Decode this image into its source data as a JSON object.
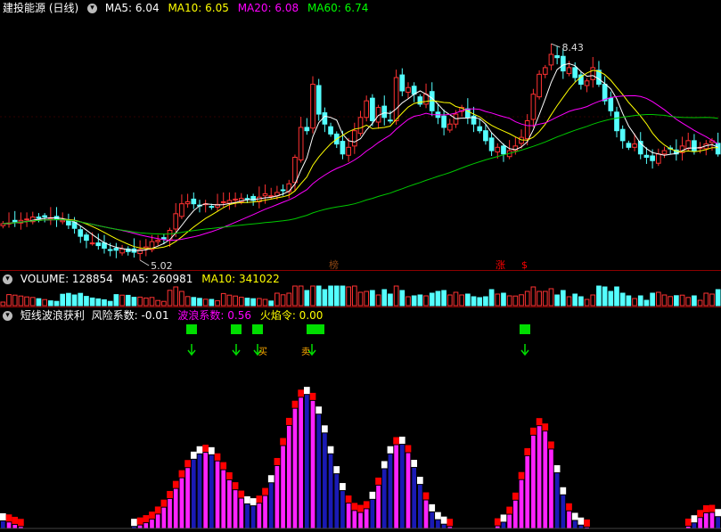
{
  "main_panel": {
    "title": "建投能源 (日线)",
    "legend": [
      {
        "label": "MA5: 6.04",
        "color": "#ffffff"
      },
      {
        "label": "MA10: 6.05",
        "color": "#ffff00"
      },
      {
        "label": "MA20: 6.08",
        "color": "#ff00ff"
      },
      {
        "label": "MA60: 6.74",
        "color": "#00ff00"
      }
    ],
    "high_label": "8.43",
    "low_label": "5.02",
    "badges": [
      "榜",
      "涨",
      "$"
    ]
  },
  "volume_panel": {
    "legend": [
      {
        "label": "VOLUME: 128854",
        "color": "#ffffff"
      },
      {
        "label": "MA5: 260981",
        "color": "#ffffff"
      },
      {
        "label": "MA10: 341022",
        "color": "#ffff00"
      }
    ]
  },
  "indicator_panel": {
    "legend": [
      {
        "label": "短线波浪获利",
        "color": "#ffffff"
      },
      {
        "label": "风险系数: -0.01",
        "color": "#ffffff"
      },
      {
        "label": "波浪系数: 0.56",
        "color": "#ff00ff"
      },
      {
        "label": "火焰令: 0.00",
        "color": "#ffff00"
      }
    ],
    "icon_labels": [
      "买",
      "卖"
    ]
  },
  "chart_data": {
    "type": "candlestick",
    "high": 8.43,
    "low": 5.02,
    "ma_last": {
      "MA5": 6.04,
      "MA10": 6.05,
      "MA20": 6.08,
      "MA60": 6.74
    },
    "volume_last": {
      "VOLUME": 128854,
      "MA5": 260981,
      "MA10": 341022
    },
    "indicator_last": {
      "风险系数": -0.01,
      "波浪系数": 0.56,
      "火焰令": 0.0
    },
    "closes": [
      5.45,
      5.46,
      5.48,
      5.5,
      5.52,
      5.55,
      5.53,
      5.55,
      5.54,
      5.52,
      5.5,
      5.43,
      5.38,
      5.26,
      5.2,
      5.16,
      5.12,
      5.08,
      5.06,
      5.05,
      5.07,
      5.03,
      5.02,
      5.06,
      5.1,
      5.18,
      5.2,
      5.22,
      5.35,
      5.6,
      5.75,
      5.78,
      5.75,
      5.72,
      5.75,
      5.7,
      5.74,
      5.78,
      5.8,
      5.82,
      5.83,
      5.82,
      5.8,
      5.85,
      5.9,
      5.87,
      5.92,
      5.95,
      6.05,
      6.45,
      6.9,
      6.85,
      7.55,
      7.1,
      6.95,
      6.8,
      6.65,
      6.5,
      6.6,
      6.85,
      7.05,
      7.3,
      7.0,
      7.2,
      7.05,
      7.0,
      7.65,
      7.45,
      7.5,
      7.4,
      7.25,
      7.4,
      7.15,
      7.05,
      6.9,
      6.95,
      7.1,
      7.2,
      7.05,
      6.95,
      6.85,
      6.7,
      6.55,
      6.6,
      6.5,
      6.55,
      6.62,
      6.75,
      7.0,
      7.4,
      7.7,
      7.8,
      8.0,
      7.95,
      7.75,
      7.8,
      7.65,
      7.55,
      7.6,
      7.8,
      7.55,
      7.3,
      7.15,
      6.85,
      6.7,
      6.6,
      6.65,
      6.5,
      6.45,
      6.4,
      6.5,
      6.55,
      6.58,
      6.5,
      6.62,
      6.7,
      6.55,
      6.6,
      6.65,
      6.7,
      6.5
    ]
  }
}
